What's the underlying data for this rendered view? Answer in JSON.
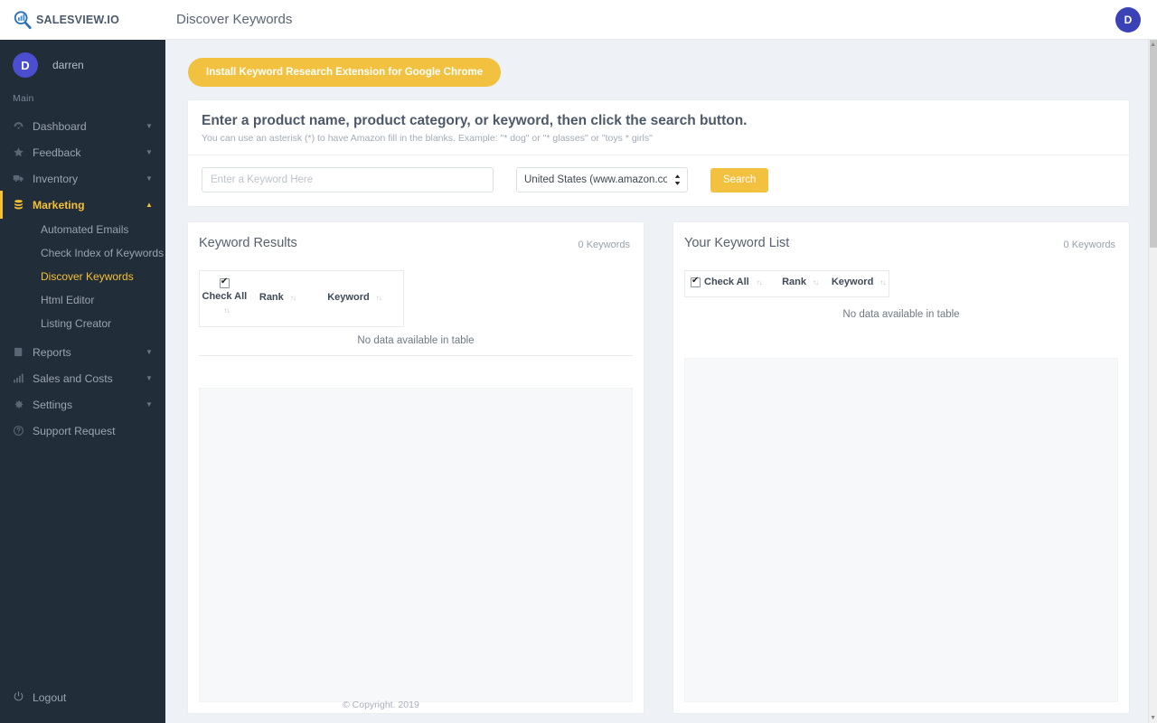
{
  "brand": {
    "name": "SALESVIEW.IO",
    "logo_icon": "magnifier-chart-icon"
  },
  "sidebar": {
    "user": {
      "initial": "D",
      "name": "darren"
    },
    "section_heading": "Main",
    "items": [
      {
        "label": "Dashboard",
        "icon": "gauge-icon",
        "has_caret": true,
        "active": false
      },
      {
        "label": "Feedback",
        "icon": "star-icon",
        "has_caret": true,
        "active": false
      },
      {
        "label": "Inventory",
        "icon": "truck-icon",
        "has_caret": true,
        "active": false
      },
      {
        "label": "Marketing",
        "icon": "database-icon",
        "has_caret": true,
        "active": true
      },
      {
        "label": "Reports",
        "icon": "book-icon",
        "has_caret": true,
        "active": false
      },
      {
        "label": "Sales and Costs",
        "icon": "bars-icon",
        "has_caret": true,
        "active": false
      },
      {
        "label": "Settings",
        "icon": "gear-icon",
        "has_caret": true,
        "active": false
      },
      {
        "label": "Support Request",
        "icon": "question-icon",
        "has_caret": false,
        "active": false
      }
    ],
    "marketing_subitems": [
      {
        "label": "Automated Emails",
        "active": false
      },
      {
        "label": "Check Index of Keywords",
        "active": false
      },
      {
        "label": "Discover Keywords",
        "active": true
      },
      {
        "label": "Html Editor",
        "active": false
      },
      {
        "label": "Listing Creator",
        "active": false
      }
    ],
    "logout": {
      "label": "Logout",
      "icon": "power-icon"
    }
  },
  "topbar": {
    "title": "Discover Keywords",
    "avatar_initial": "D"
  },
  "main": {
    "install_button": "Install Keyword Research Extension for Google Chrome",
    "search_card": {
      "title": "Enter a product name, product category, or keyword, then click the search button.",
      "subtitle": "You can use an asterisk (*) to have Amazon fill in the blanks. Example: \"* dog\" or \"* glasses\" or \"toys * girls\"",
      "keyword_placeholder": "Enter a Keyword Here",
      "keyword_value": "",
      "marketplace_selected": "United States (www.amazon.com)",
      "marketplace_options": [
        "United States (www.amazon.com)"
      ],
      "search_button": "Search"
    },
    "results_panel": {
      "title": "Keyword Results",
      "count": "0 Keywords",
      "columns": [
        "Check All",
        "Rank",
        "Keyword"
      ],
      "empty_text": "No data available in table",
      "check_all_checked": true
    },
    "list_panel": {
      "title": "Your Keyword List",
      "count": "0 Keywords",
      "columns": [
        "Check All",
        "Rank",
        "Keyword"
      ],
      "empty_text": "No data available in table",
      "check_all_checked": true
    }
  },
  "footer": {
    "copyright": "© Copyright. 2019"
  },
  "colors": {
    "sidebar_bg": "#222d3a",
    "accent_yellow": "#f2c13f",
    "avatar_purple": "#4b4fcf",
    "page_bg": "#eef2f6"
  }
}
